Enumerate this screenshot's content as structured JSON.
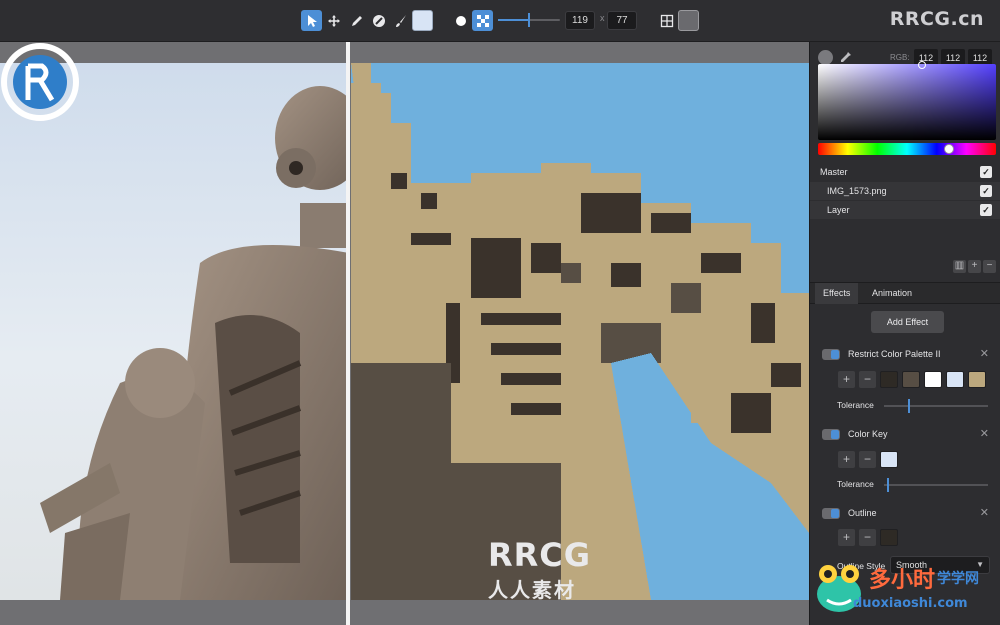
{
  "toolbar": {
    "tools": [
      {
        "name": "select-tool",
        "icon": "arrow-icon",
        "active": true
      },
      {
        "name": "move-tool",
        "icon": "move-icon",
        "active": false
      },
      {
        "name": "pencil-tool",
        "icon": "pencil-icon",
        "active": false
      },
      {
        "name": "eraser-tool",
        "icon": "eraser-icon",
        "active": false
      },
      {
        "name": "brush-tool",
        "icon": "brush-icon",
        "active": false
      }
    ],
    "primary_color": "#d8e4f5",
    "width_value": "119",
    "height_value": "77",
    "size_separator": "x",
    "slider_level": 0.48
  },
  "watermark_top": "RRCG.cn",
  "canvas": {
    "logo_big": "RRCG",
    "logo_small": "人人素材"
  },
  "panel": {
    "rgb_label": "RGB:",
    "rgb": [
      "112",
      "112",
      "112"
    ],
    "layers": {
      "master": "Master",
      "items": [
        "IMG_1573.png",
        "Layer"
      ]
    },
    "tabs": [
      "Effects",
      "Animation"
    ],
    "add_effect": "Add Effect",
    "effects": [
      {
        "title": "Restrict Color Palette II",
        "tolerance_label": "Tolerance",
        "swatches": [
          "#2e2a25",
          "#574e44",
          "#ffffff",
          "#d8e4f5",
          "#bca87e"
        ]
      },
      {
        "title": "Color Key",
        "tolerance_label": "Tolerance",
        "swatches": [
          "#d8e4f5"
        ]
      },
      {
        "title": "Outline",
        "swatches": [
          "#2e2a25"
        ]
      }
    ],
    "outline_style_label": "Outline Style",
    "outline_style_value": "Smooth"
  },
  "watermark_bottom": {
    "brand": "多小时",
    "sub": "学学网",
    "url": "duoxiaoshi.com"
  }
}
